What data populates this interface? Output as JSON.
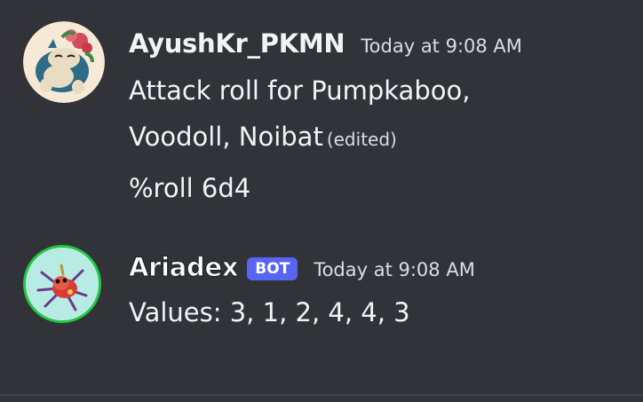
{
  "messages": [
    {
      "username": "AyushKr_PKMN",
      "timestamp": "Today at 9:08 AM",
      "lines": [
        "Attack roll for Pumpkaboo,",
        "Voodoll, Noibat",
        "%roll 6d4"
      ],
      "edited_label": "(edited)",
      "avatar_icon": "snorlax-avatar-icon"
    },
    {
      "username": "Ariadex",
      "bot_tag": "BOT",
      "timestamp": "Today at 9:08 AM",
      "lines": [
        "Values: 3, 1, 2, 4, 4, 3"
      ],
      "avatar_icon": "ariados-avatar-icon"
    }
  ],
  "colors": {
    "background": "#313338",
    "bot_tag": "#5865f2",
    "online_ring": "#23c840"
  }
}
